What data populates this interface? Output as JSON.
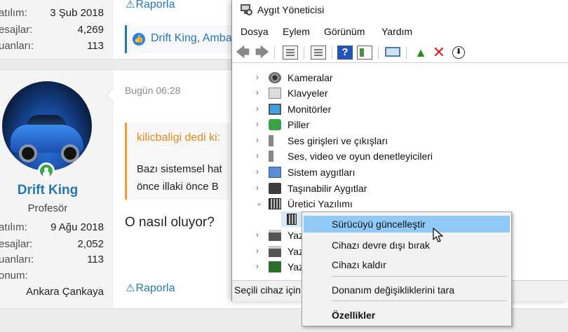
{
  "forum": {
    "post1": {
      "stats": [
        {
          "label": "atılım:",
          "value": "3 Şub 2018"
        },
        {
          "label": "esajlar:",
          "value": "4,269"
        },
        {
          "label": "uanları:",
          "value": "113"
        }
      ],
      "report": "Raporla",
      "likes": "Drift King, Amba"
    },
    "post2": {
      "username": "Drift King",
      "rank": "Profesör",
      "stats": [
        {
          "label": "atılım:",
          "value": "9 Ağu 2018"
        },
        {
          "label": "esajlar:",
          "value": "2,052"
        },
        {
          "label": "uanları:",
          "value": "113"
        },
        {
          "label": "onum:",
          "value": ""
        }
      ],
      "location": "Ankara Çankaya",
      "date": "Bugün 06:28",
      "quote_header": "kilicbaligi dedi ki:",
      "quote_line1": "Bazı sistemsel hat",
      "quote_line2": "önce illaki önce B",
      "body": "O nasıl oluyor?",
      "report": "Raporla"
    }
  },
  "window": {
    "title": "Aygıt Yöneticisi",
    "menus": [
      "Dosya",
      "Eylem",
      "Görünüm",
      "Yardım"
    ],
    "tree": [
      {
        "label": "Kameralar",
        "icon": "camera-icon"
      },
      {
        "label": "Klavyeler",
        "icon": "keyboard-icon"
      },
      {
        "label": "Monitörler",
        "icon": "monitor-icon"
      },
      {
        "label": "Piller",
        "icon": "battery-icon"
      },
      {
        "label": "Ses girişleri ve çıkışları",
        "icon": "speaker-icon"
      },
      {
        "label": "Ses, video ve oyun denetleyicileri",
        "icon": "speaker-icon"
      },
      {
        "label": "Sistem aygıtları",
        "icon": "system-device-icon"
      },
      {
        "label": "Taşınabilir Aygıtlar",
        "icon": "portable-device-icon"
      },
      {
        "label": "Üretici Yazılımı",
        "icon": "firmware-chip-icon",
        "expanded": true
      },
      {
        "label": "Yaz",
        "icon": "printer-icon"
      },
      {
        "label": "Yaz",
        "icon": "print-queue-icon"
      },
      {
        "label": "Yaz",
        "icon": "software-device-icon"
      }
    ],
    "status": "Seçili cihaz için"
  },
  "context_menu": {
    "items": [
      {
        "label": "Sürücüyü güncelleştir",
        "highlighted": true
      },
      {
        "label": "Cihazı devre dışı bırak"
      },
      {
        "label": "Cihazı kaldır"
      },
      {
        "label": "Donanım değişikliklerini tara"
      },
      {
        "label": "Özellikler",
        "bold": true
      }
    ]
  },
  "colors": {
    "link": "#2577b1",
    "quote_accent": "#f39d2a",
    "highlight": "#91c9f7",
    "online": "#3ca54b"
  }
}
